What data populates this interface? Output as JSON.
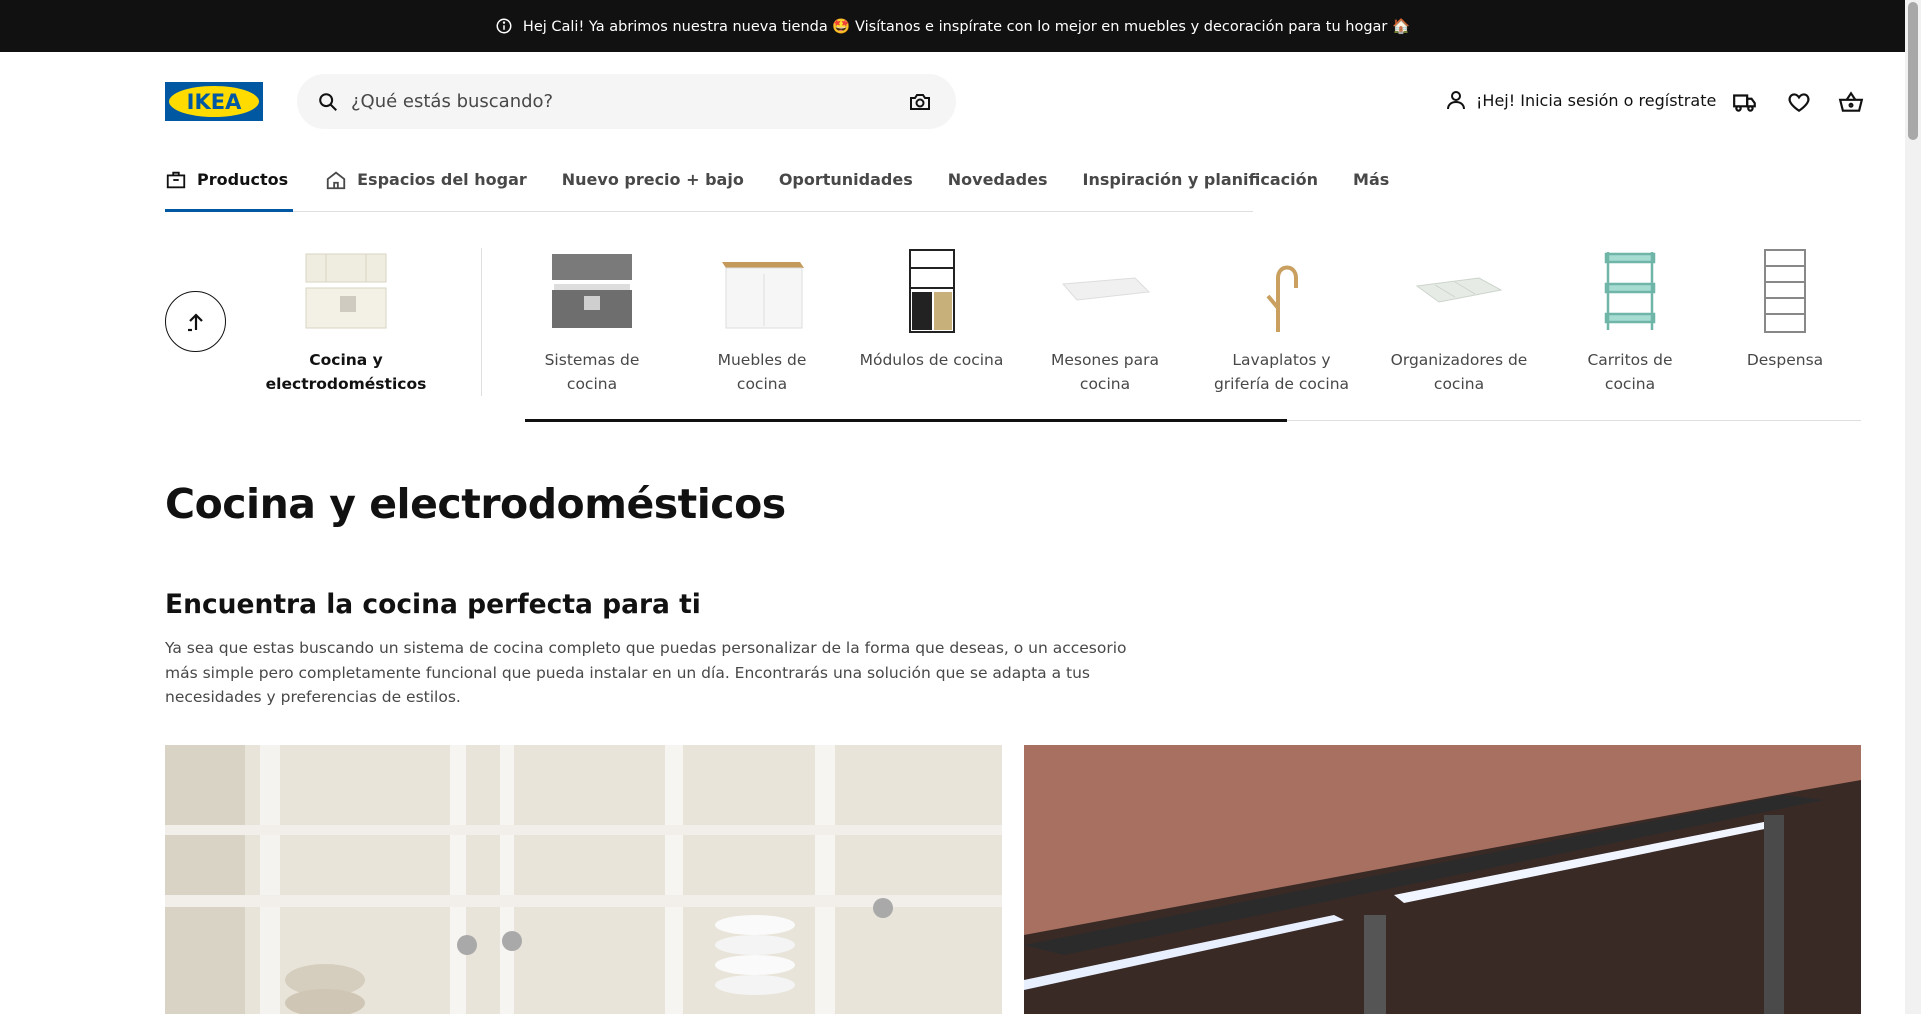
{
  "promo": {
    "text": "Hej Cali! Ya abrimos nuestra nueva tienda 🤩 Visítanos e inspírate con lo mejor en muebles y decoración para tu hogar 🏠"
  },
  "header": {
    "logo_text": "IKEA",
    "search_placeholder": "¿Qué estás buscando?",
    "account_label": "¡Hej! Inicia sesión o regístrate"
  },
  "nav": {
    "tabs": [
      {
        "label": "Productos",
        "icon": "product-box-icon",
        "active": true
      },
      {
        "label": "Espacios del hogar",
        "icon": "home-icon",
        "active": false
      },
      {
        "label": "Nuevo precio + bajo"
      },
      {
        "label": "Oportunidades"
      },
      {
        "label": "Novedades"
      },
      {
        "label": "Inspiración y planificación"
      },
      {
        "label": "Más"
      }
    ]
  },
  "categories": {
    "current": "Cocina y electrodomésticos",
    "items": [
      "Sistemas de cocina",
      "Muebles de cocina",
      "Módulos de cocina",
      "Mesones para cocina",
      "Lavaplatos y grifería de cocina",
      "Organizadores de cocina",
      "Carritos de cocina",
      "Despensa"
    ],
    "scroll_progress": 0.57
  },
  "content": {
    "title": "Cocina y electrodomésticos",
    "subtitle": "Encuentra la cocina perfecta para ti",
    "description": "Ya sea que estas buscando un sistema de cocina completo que puedas personalizar de la forma que deseas, o un accesorio más simple pero completamente funcional que pueda instalar en un día. Encontrarás una solución que se adapta a tus necesidades y preferencias de estilos."
  },
  "colors": {
    "brand_blue": "#0058a3",
    "brand_yellow": "#ffdb00",
    "promo_bg": "#111111"
  }
}
